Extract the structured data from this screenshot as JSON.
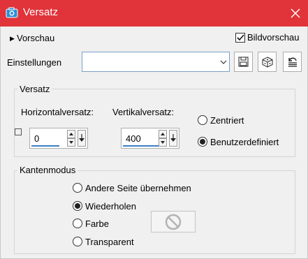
{
  "window": {
    "title": "Versatz",
    "app_icon": "camera-icon",
    "close_icon": "close-icon",
    "titlebar_color": "#e0343a"
  },
  "preview": {
    "toggle_label": "Vorschau",
    "image_preview_label": "Bildvorschau",
    "image_preview_checked": true
  },
  "settings": {
    "label": "Einstellungen",
    "value": "",
    "buttons": [
      "save-icon",
      "dice-icon",
      "reset-icon"
    ]
  },
  "offset_group": {
    "title": "Versatz",
    "horizontal_label": "Horizontalversatz:",
    "horizontal_value": "0",
    "vertical_label": "Vertikalversatz:",
    "vertical_value": "400",
    "options": [
      {
        "label": "Zentriert",
        "selected": false
      },
      {
        "label": "Benutzerdefiniert",
        "selected": true
      }
    ]
  },
  "edge_group": {
    "title": "Kantenmodus",
    "options": [
      {
        "label": "Andere Seite übernehmen",
        "selected": false
      },
      {
        "label": "Wiederholen",
        "selected": true
      },
      {
        "label": "Farbe",
        "selected": false
      },
      {
        "label": "Transparent",
        "selected": false
      }
    ],
    "color_swatch_icon": "no-symbol-icon"
  }
}
